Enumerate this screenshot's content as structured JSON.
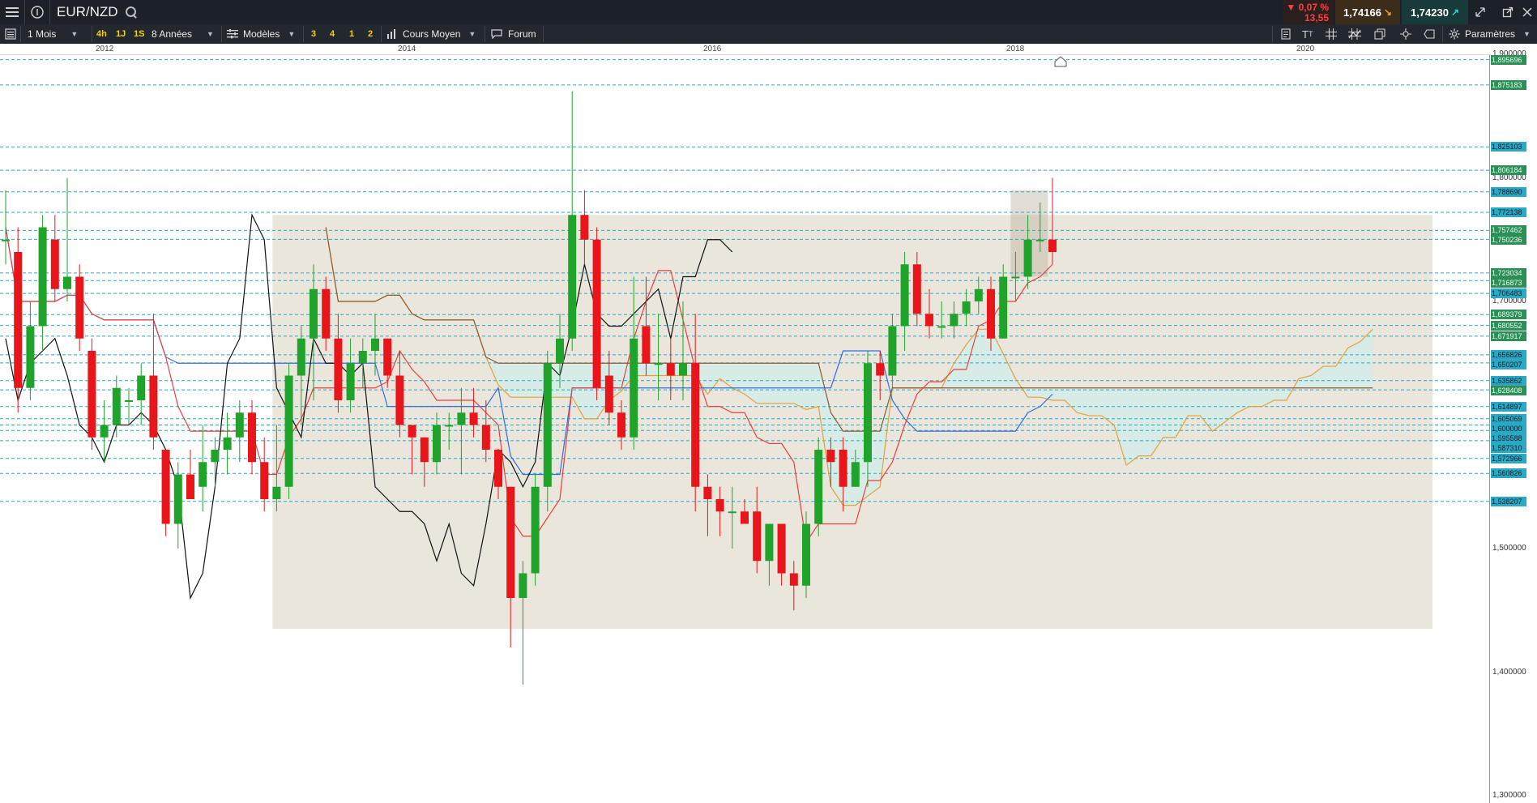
{
  "topbar": {
    "symbol": "EUR/NZD",
    "change_pct": "▼ 0,07 %",
    "change_pts": "13,55",
    "bid": "1,74166",
    "ask": "1,74230"
  },
  "toolbar": {
    "timeframe": "1 Mois",
    "quick_periods": [
      "4h",
      "1J",
      "1S"
    ],
    "range": "8 Années",
    "models": "Modèles",
    "layout_counts": [
      "3",
      "4",
      "1",
      "2"
    ],
    "price_type": "Cours Moyen",
    "forum": "Forum",
    "settings": "Paramètres"
  },
  "colors": {
    "bull": "#1fa32a",
    "bear": "#e8161b",
    "tenkan": "#e84040",
    "kijun": "#2f6fe0",
    "chikou": "#111111",
    "senkou_a": "#e1a23a",
    "senkou_b": "#8c5a35",
    "cloud": "#bff3f5",
    "zone": "#e9e3d8",
    "level_line": "#29a9c4"
  },
  "chart_data": {
    "type": "candlestick",
    "title": "",
    "x_axis_labels": [
      "2012",
      "2014",
      "2016",
      "2018",
      "2020"
    ],
    "y_axis_labels": [
      "1,900000",
      "1,800000",
      "1,700000",
      "1,600000",
      "1,500000",
      "1,400000",
      "1,300000"
    ],
    "ylim": [
      1.3,
      1.9
    ],
    "price_levels": [
      "1,895696",
      "1,875183",
      "1,825103",
      "1,806184",
      "1,788690",
      "1,772138",
      "1,757462",
      "1,750236",
      "1,723034",
      "1,716873",
      "1,706483",
      "1,689379",
      "1,680552",
      "1,671917",
      "1,656826",
      "1,650207",
      "1,635862",
      "1,628408",
      "1,614897",
      "1,605069",
      "1,600000",
      "1,595588",
      "1,587310",
      "1,572966",
      "1,560826",
      "1,538207"
    ],
    "candles": [
      {
        "o": 1.75,
        "h": 1.79,
        "l": 1.73,
        "c": 1.75
      },
      {
        "o": 1.74,
        "h": 1.76,
        "l": 1.61,
        "c": 1.63
      },
      {
        "o": 1.63,
        "h": 1.7,
        "l": 1.62,
        "c": 1.68
      },
      {
        "o": 1.68,
        "h": 1.77,
        "l": 1.66,
        "c": 1.76
      },
      {
        "o": 1.75,
        "h": 1.77,
        "l": 1.7,
        "c": 1.71
      },
      {
        "o": 1.71,
        "h": 1.8,
        "l": 1.7,
        "c": 1.72
      },
      {
        "o": 1.72,
        "h": 1.73,
        "l": 1.66,
        "c": 1.67
      },
      {
        "o": 1.66,
        "h": 1.67,
        "l": 1.58,
        "c": 1.59
      },
      {
        "o": 1.59,
        "h": 1.62,
        "l": 1.57,
        "c": 1.6
      },
      {
        "o": 1.6,
        "h": 1.64,
        "l": 1.59,
        "c": 1.63
      },
      {
        "o": 1.62,
        "h": 1.63,
        "l": 1.6,
        "c": 1.62
      },
      {
        "o": 1.62,
        "h": 1.65,
        "l": 1.6,
        "c": 1.64
      },
      {
        "o": 1.64,
        "h": 1.69,
        "l": 1.58,
        "c": 1.59
      },
      {
        "o": 1.58,
        "h": 1.58,
        "l": 1.51,
        "c": 1.52
      },
      {
        "o": 1.52,
        "h": 1.57,
        "l": 1.5,
        "c": 1.56
      },
      {
        "o": 1.56,
        "h": 1.58,
        "l": 1.54,
        "c": 1.54
      },
      {
        "o": 1.55,
        "h": 1.6,
        "l": 1.53,
        "c": 1.57
      },
      {
        "o": 1.57,
        "h": 1.59,
        "l": 1.55,
        "c": 1.58
      },
      {
        "o": 1.58,
        "h": 1.61,
        "l": 1.56,
        "c": 1.59
      },
      {
        "o": 1.59,
        "h": 1.62,
        "l": 1.57,
        "c": 1.61
      },
      {
        "o": 1.61,
        "h": 1.62,
        "l": 1.56,
        "c": 1.57
      },
      {
        "o": 1.57,
        "h": 1.59,
        "l": 1.53,
        "c": 1.54
      },
      {
        "o": 1.54,
        "h": 1.6,
        "l": 1.53,
        "c": 1.55
      },
      {
        "o": 1.55,
        "h": 1.65,
        "l": 1.54,
        "c": 1.64
      },
      {
        "o": 1.64,
        "h": 1.68,
        "l": 1.6,
        "c": 1.67
      },
      {
        "o": 1.67,
        "h": 1.73,
        "l": 1.62,
        "c": 1.71
      },
      {
        "o": 1.71,
        "h": 1.72,
        "l": 1.66,
        "c": 1.67
      },
      {
        "o": 1.67,
        "h": 1.69,
        "l": 1.61,
        "c": 1.62
      },
      {
        "o": 1.62,
        "h": 1.67,
        "l": 1.61,
        "c": 1.65
      },
      {
        "o": 1.65,
        "h": 1.67,
        "l": 1.63,
        "c": 1.66
      },
      {
        "o": 1.66,
        "h": 1.69,
        "l": 1.64,
        "c": 1.67
      },
      {
        "o": 1.67,
        "h": 1.67,
        "l": 1.63,
        "c": 1.64
      },
      {
        "o": 1.64,
        "h": 1.66,
        "l": 1.59,
        "c": 1.6
      },
      {
        "o": 1.6,
        "h": 1.6,
        "l": 1.56,
        "c": 1.59
      },
      {
        "o": 1.59,
        "h": 1.59,
        "l": 1.55,
        "c": 1.57
      },
      {
        "o": 1.57,
        "h": 1.61,
        "l": 1.56,
        "c": 1.6
      },
      {
        "o": 1.6,
        "h": 1.61,
        "l": 1.58,
        "c": 1.6
      },
      {
        "o": 1.6,
        "h": 1.63,
        "l": 1.56,
        "c": 1.61
      },
      {
        "o": 1.61,
        "h": 1.63,
        "l": 1.59,
        "c": 1.6
      },
      {
        "o": 1.6,
        "h": 1.62,
        "l": 1.57,
        "c": 1.58
      },
      {
        "o": 1.58,
        "h": 1.58,
        "l": 1.54,
        "c": 1.55
      },
      {
        "o": 1.55,
        "h": 1.55,
        "l": 1.42,
        "c": 1.46
      },
      {
        "o": 1.46,
        "h": 1.49,
        "l": 1.39,
        "c": 1.48
      },
      {
        "o": 1.48,
        "h": 1.56,
        "l": 1.47,
        "c": 1.55
      },
      {
        "o": 1.55,
        "h": 1.66,
        "l": 1.53,
        "c": 1.65
      },
      {
        "o": 1.65,
        "h": 1.69,
        "l": 1.63,
        "c": 1.67
      },
      {
        "o": 1.67,
        "h": 1.87,
        "l": 1.66,
        "c": 1.77
      },
      {
        "o": 1.77,
        "h": 1.79,
        "l": 1.73,
        "c": 1.75
      },
      {
        "o": 1.75,
        "h": 1.76,
        "l": 1.62,
        "c": 1.63
      },
      {
        "o": 1.64,
        "h": 1.66,
        "l": 1.6,
        "c": 1.61
      },
      {
        "o": 1.61,
        "h": 1.62,
        "l": 1.58,
        "c": 1.59
      },
      {
        "o": 1.59,
        "h": 1.72,
        "l": 1.58,
        "c": 1.67
      },
      {
        "o": 1.68,
        "h": 1.72,
        "l": 1.64,
        "c": 1.65
      },
      {
        "o": 1.65,
        "h": 1.69,
        "l": 1.62,
        "c": 1.65
      },
      {
        "o": 1.65,
        "h": 1.67,
        "l": 1.62,
        "c": 1.64
      },
      {
        "o": 1.64,
        "h": 1.7,
        "l": 1.62,
        "c": 1.65
      },
      {
        "o": 1.65,
        "h": 1.69,
        "l": 1.53,
        "c": 1.55
      },
      {
        "o": 1.55,
        "h": 1.56,
        "l": 1.51,
        "c": 1.54
      },
      {
        "o": 1.54,
        "h": 1.55,
        "l": 1.51,
        "c": 1.53
      },
      {
        "o": 1.53,
        "h": 1.55,
        "l": 1.5,
        "c": 1.53
      },
      {
        "o": 1.53,
        "h": 1.54,
        "l": 1.52,
        "c": 1.52
      },
      {
        "o": 1.53,
        "h": 1.55,
        "l": 1.48,
        "c": 1.49
      },
      {
        "o": 1.49,
        "h": 1.52,
        "l": 1.47,
        "c": 1.52
      },
      {
        "o": 1.52,
        "h": 1.52,
        "l": 1.47,
        "c": 1.48
      },
      {
        "o": 1.48,
        "h": 1.49,
        "l": 1.45,
        "c": 1.47
      },
      {
        "o": 1.47,
        "h": 1.53,
        "l": 1.46,
        "c": 1.52
      },
      {
        "o": 1.52,
        "h": 1.59,
        "l": 1.51,
        "c": 1.58
      },
      {
        "o": 1.58,
        "h": 1.59,
        "l": 1.55,
        "c": 1.57
      },
      {
        "o": 1.58,
        "h": 1.59,
        "l": 1.53,
        "c": 1.55
      },
      {
        "o": 1.55,
        "h": 1.58,
        "l": 1.55,
        "c": 1.57
      },
      {
        "o": 1.57,
        "h": 1.66,
        "l": 1.55,
        "c": 1.65
      },
      {
        "o": 1.65,
        "h": 1.66,
        "l": 1.62,
        "c": 1.64
      },
      {
        "o": 1.64,
        "h": 1.69,
        "l": 1.63,
        "c": 1.68
      },
      {
        "o": 1.68,
        "h": 1.74,
        "l": 1.66,
        "c": 1.73
      },
      {
        "o": 1.73,
        "h": 1.74,
        "l": 1.68,
        "c": 1.69
      },
      {
        "o": 1.69,
        "h": 1.71,
        "l": 1.67,
        "c": 1.68
      },
      {
        "o": 1.68,
        "h": 1.7,
        "l": 1.67,
        "c": 1.68
      },
      {
        "o": 1.68,
        "h": 1.7,
        "l": 1.67,
        "c": 1.69
      },
      {
        "o": 1.69,
        "h": 1.71,
        "l": 1.68,
        "c": 1.7
      },
      {
        "o": 1.7,
        "h": 1.72,
        "l": 1.69,
        "c": 1.71
      },
      {
        "o": 1.71,
        "h": 1.72,
        "l": 1.66,
        "c": 1.67
      },
      {
        "o": 1.67,
        "h": 1.73,
        "l": 1.67,
        "c": 1.72
      },
      {
        "o": 1.72,
        "h": 1.74,
        "l": 1.7,
        "c": 1.72
      },
      {
        "o": 1.72,
        "h": 1.77,
        "l": 1.71,
        "c": 1.75
      },
      {
        "o": 1.75,
        "h": 1.78,
        "l": 1.74,
        "c": 1.75
      },
      {
        "o": 1.75,
        "h": 1.8,
        "l": 1.73,
        "c": 1.74
      }
    ]
  }
}
